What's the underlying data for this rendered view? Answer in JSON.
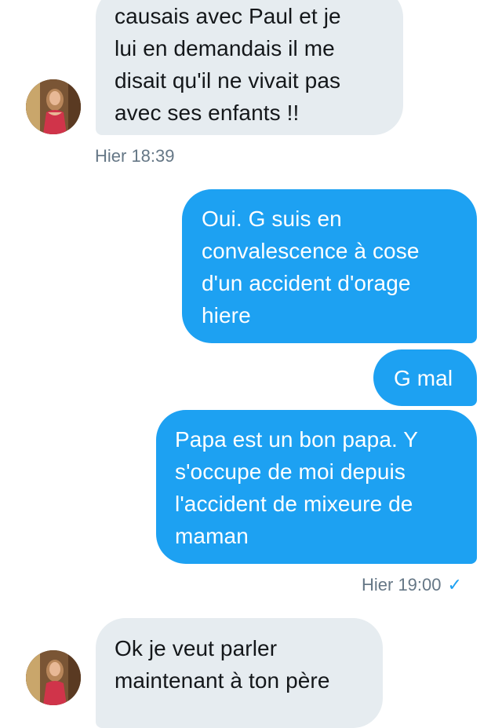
{
  "conversation": {
    "messages": [
      {
        "direction": "incoming",
        "text": "causais avec Paul et je\nlui en demandais il me\ndisait qu'il ne vivait pas\navec ses enfants !!"
      },
      {
        "direction": "outgoing",
        "text": "Oui. G suis en\nconvalescence à cose\nd'un accident d'orage\nhiere"
      },
      {
        "direction": "outgoing",
        "text": "G mal"
      },
      {
        "direction": "outgoing",
        "text": "Papa est un bon papa. Y\ns'occupe de moi depuis\nl'accident de mixeure de\nmaman"
      },
      {
        "direction": "incoming",
        "text": "Ok je veut parler\nmaintenant à ton père"
      }
    ],
    "timestamps": {
      "incoming_1": "Hier 18:39",
      "outgoing_1": "Hier 19:00"
    },
    "read_receipt_icon": "checkmark-icon"
  },
  "colors": {
    "incoming_bubble": "#e6ecf0",
    "outgoing_bubble": "#1da1f2",
    "timestamp_text": "#657786",
    "checkmark": "#1da1f2"
  }
}
